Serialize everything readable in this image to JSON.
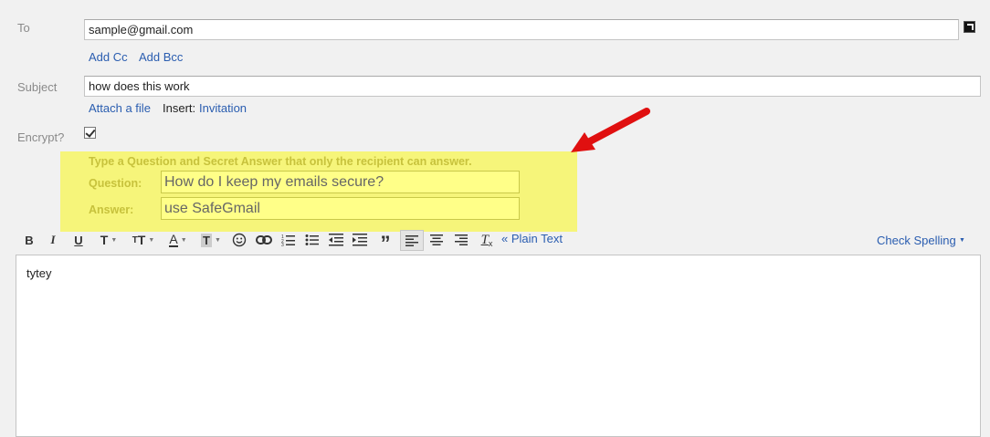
{
  "to": {
    "label": "To",
    "value": "sample@gmail.com",
    "add_cc": "Add Cc",
    "add_bcc": "Add Bcc"
  },
  "subject": {
    "label": "Subject",
    "value": "how does this work",
    "attach": "Attach a file",
    "insert_label": "Insert:",
    "invitation": "Invitation"
  },
  "encrypt": {
    "label": "Encrypt?",
    "checked": true
  },
  "qa": {
    "instruction": "Type a Question and Secret Answer that only the recipient can answer.",
    "question_label": "Question:",
    "question_value": "How do I keep my emails secure?",
    "answer_label": "Answer:",
    "answer_value": "use SafeGmail"
  },
  "toolbar": {
    "bold": "B",
    "italic": "I",
    "underline": "U",
    "plain_text": "« Plain Text",
    "check_spelling": "Check Spelling"
  },
  "body": {
    "text": "tytey"
  },
  "colors": {
    "link": "#2a5db0",
    "highlight": "#f6f57a",
    "arrow": "#e01010"
  }
}
